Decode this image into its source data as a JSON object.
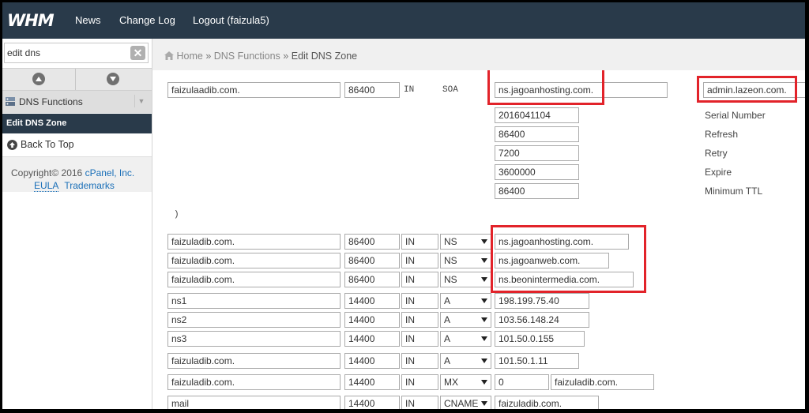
{
  "topbar": {
    "logo": "WHM",
    "nav": [
      "News",
      "Change Log",
      "Logout (faizula5)"
    ]
  },
  "sidebar": {
    "search_value": "edit dns",
    "clear_icon": "clear-x-icon",
    "section_label": "DNS Functions",
    "active_item": "Edit DNS Zone",
    "back_to_top": "Back To Top",
    "copyright_prefix": "Copyright© 2016 ",
    "copyright_link": "cPanel, Inc.",
    "eula": "EULA",
    "trademarks": "Trademarks"
  },
  "breadcrumb": {
    "home": "Home",
    "sep": "»",
    "section": "DNS Functions",
    "current": "Edit DNS Zone"
  },
  "soa": {
    "name": "faizulaadib.com.",
    "ttl": "86400",
    "class": "IN",
    "type": "SOA",
    "primary_ns": "ns.jagoanhosting.com.",
    "admin_email": "admin.lazeon.com.",
    "fields": [
      {
        "value": "2016041104",
        "label": "Serial Number"
      },
      {
        "value": "86400",
        "label": "Refresh"
      },
      {
        "value": "7200",
        "label": "Retry"
      },
      {
        "value": "3600000",
        "label": "Expire"
      },
      {
        "value": "86400",
        "label": "Minimum TTL"
      }
    ],
    "close_paren": ")"
  },
  "records": [
    {
      "name": "faizuladib.com.",
      "ttl": "86400",
      "class": "IN",
      "type": "NS",
      "value": "ns.jagoanhosting.com."
    },
    {
      "name": "faizuladib.com.",
      "ttl": "86400",
      "class": "IN",
      "type": "NS",
      "value": "ns.jagoanweb.com."
    },
    {
      "name": "faizuladib.com.",
      "ttl": "86400",
      "class": "IN",
      "type": "NS",
      "value": "ns.beonintermedia.com."
    },
    {
      "name": "ns1",
      "ttl": "14400",
      "class": "IN",
      "type": "A",
      "value": "198.199.75.40"
    },
    {
      "name": "ns2",
      "ttl": "14400",
      "class": "IN",
      "type": "A",
      "value": "103.56.148.24"
    },
    {
      "name": "ns3",
      "ttl": "14400",
      "class": "IN",
      "type": "A",
      "value": "101.50.0.155"
    },
    {
      "name": "faizuladib.com.",
      "ttl": "14400",
      "class": "IN",
      "type": "A",
      "value": "101.50.1.11"
    },
    {
      "name": "faizuladib.com.",
      "ttl": "14400",
      "class": "IN",
      "type": "MX",
      "priority": "0",
      "value": "faizuladib.com."
    },
    {
      "name": "mail",
      "ttl": "14400",
      "class": "IN",
      "type": "CNAME",
      "value": "faizuladib.com."
    }
  ],
  "colors": {
    "topbar": "#293a4a",
    "highlight": "#e2232a",
    "link": "#1a6fb8"
  }
}
